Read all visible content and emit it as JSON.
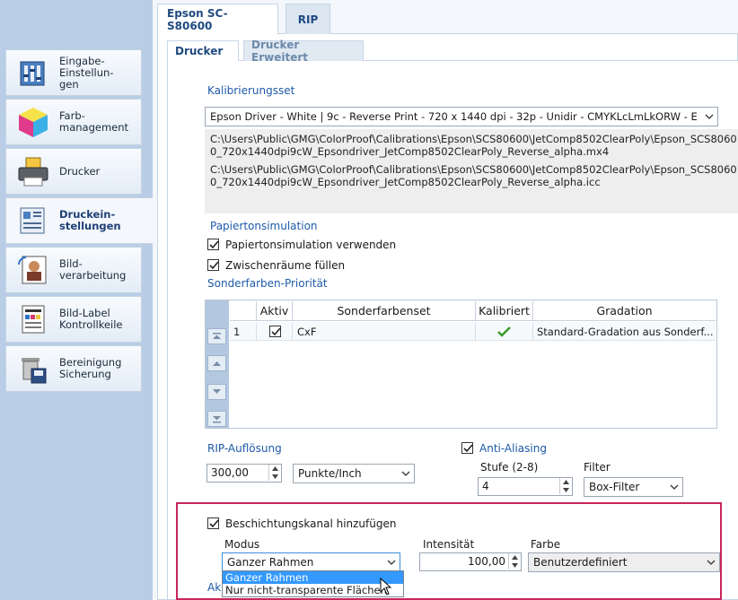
{
  "sidebar": {
    "items": [
      {
        "label": "Eingabe-\nEinstellun-\ngen",
        "icon": "input-settings-icon"
      },
      {
        "label": "Farb-\nmanagement",
        "icon": "color-cube-icon"
      },
      {
        "label": "Drucker",
        "icon": "printer-icon"
      },
      {
        "label": "Druckein-\nstellungen",
        "icon": "print-settings-icon",
        "active": true
      },
      {
        "label": "Bild-\nverarbeitung",
        "icon": "image-processing-icon"
      },
      {
        "label": "Bild-Label\nKontrollkeile",
        "icon": "image-label-icon"
      },
      {
        "label": "Bereinigung\nSicherung",
        "icon": "trash-backup-icon"
      }
    ]
  },
  "tabs": {
    "printer": "Epson SC-S80600",
    "rip": "RIP"
  },
  "subtabs": {
    "drucker": "Drucker",
    "erweitert": "Drucker Erweitert"
  },
  "kalibrierung": {
    "label": "Kalibrierungsset",
    "selected": "Epson Driver - White | 9c - Reverse Print - 720 x 1440 dpi - 32p - Unidir - CMYKLcLmLkORW - E",
    "path1": "C:\\Users\\Public\\GMG\\ColorProof\\Calibrations\\Epson\\SCS80600\\JetComp8502ClearPoly\\Epson_SCS80600_720x1440dpi9cW_Epsondriver_JetComp8502ClearPoly_Reverse_alpha.mx4",
    "path2": "C:\\Users\\Public\\GMG\\ColorProof\\Calibrations\\Epson\\SCS80600\\JetComp8502ClearPoly\\Epson_SCS80600_720x1440dpi9cW_Epsondriver_JetComp8502ClearPoly_Reverse_alpha.icc"
  },
  "papier": {
    "label": "Papiertonsimulation",
    "use_label": "Papiertonsimulation verwenden",
    "fill_label": "Zwischenräume füllen"
  },
  "sonderfarben": {
    "label": "Sonderfarben-Priorität",
    "columns": [
      "Aktiv",
      "Sonderfarbenset",
      "Kalibriert",
      "Gradation"
    ],
    "rows": [
      {
        "num": "1",
        "aktiv": true,
        "set": "CxF",
        "kalibriert": true,
        "gradation": "Standard-Gradation aus Sonderf..."
      }
    ]
  },
  "rip_aufloesung": {
    "label": "RIP-Auflösung",
    "value": "300,00",
    "unit": "Punkte/Inch"
  },
  "anti_aliasing": {
    "label": "Anti-Aliasing",
    "stufe_label": "Stufe (2-8)",
    "stufe_value": "4",
    "filter_label": "Filter",
    "filter_value": "Box-Filter"
  },
  "beschichtung": {
    "checkbox_label": "Beschichtungskanal hinzufügen",
    "modus_label": "Modus",
    "modus_value": "Ganzer Rahmen",
    "intensitaet_label": "Intensität",
    "intensitaet_value": "100,00",
    "farbe_label": "Farbe",
    "farbe_value": "Benutzerdefiniert",
    "options": [
      "Ganzer Rahmen",
      "Nur nicht-transparente Flächen"
    ],
    "truncated_label": "Ak"
  },
  "colors": {
    "accent": "#1e5aa8",
    "highlight": "#c8265a",
    "sidebar": "#b9cee6"
  }
}
